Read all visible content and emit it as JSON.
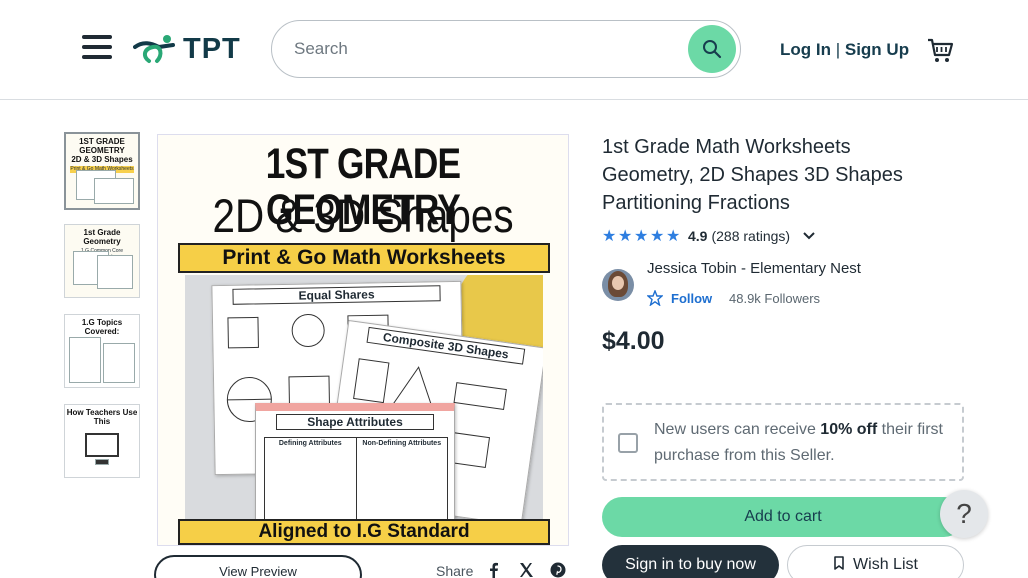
{
  "header": {
    "logo_text": "TPT",
    "search_placeholder": "Search",
    "auth_login": "Log In",
    "auth_sep": " | ",
    "auth_signup": "Sign Up"
  },
  "thumbnails": [
    {
      "title": "1ST GRADE GEOMETRY\n2D & 3D Shapes",
      "band": "Print & Go Math Worksheets",
      "active": true
    },
    {
      "title": "1st Grade Geometry",
      "band": "1.G Common Core Worksheets"
    },
    {
      "title": "1.G Topics Covered:",
      "band": ""
    },
    {
      "title": "How Teachers Use This",
      "band": ""
    }
  ],
  "main_image": {
    "title_line1": "1ST GRADE GEOMETRY",
    "title_line2": "2D & 3D Shapes",
    "band": "Print & Go Math Worksheets",
    "sheet_a": "Equal Shares",
    "sheet_b": "Composite 3D Shapes",
    "sheet_c": "Shape Attributes",
    "sheet_c_col1": "Defining Attributes",
    "sheet_c_col2": "Non-Defining Attributes",
    "bottom_band": "Aligned to I.G Standard"
  },
  "actions": {
    "view_preview": "View Preview",
    "share_label": "Share"
  },
  "product": {
    "title": "1st Grade Math Worksheets Geometry, 2D Shapes 3D Shapes Partitioning Fractions",
    "rating_value": "4.9",
    "rating_count": "(288 ratings)",
    "rating_stars": 5,
    "seller_name": "Jessica Tobin - Elementary Nest",
    "follow_label": "Follow",
    "followers": "48.9k Followers",
    "price": "$4.00"
  },
  "promo": {
    "text_before": "New users can receive ",
    "text_bold": "10% off",
    "text_after": " their first purchase from this Seller."
  },
  "buttons": {
    "add_to_cart": "Add to cart",
    "sign_in_to_buy": "Sign in to buy now",
    "wish_list": "Wish List",
    "help": "?"
  },
  "colors": {
    "accent_green": "#6cd9a6",
    "dark_navy": "#23313b",
    "star_blue": "#2e7ee0",
    "follow_blue": "#1e6fd0",
    "yellow_band": "#f6cf47"
  },
  "icons": [
    "menu-icon",
    "tpt-logo-icon",
    "search-icon",
    "cart-icon",
    "star-icon",
    "chevron-down-icon",
    "follow-star-icon",
    "facebook-icon",
    "x-icon",
    "pinterest-icon",
    "bookmark-icon",
    "help-icon"
  ]
}
